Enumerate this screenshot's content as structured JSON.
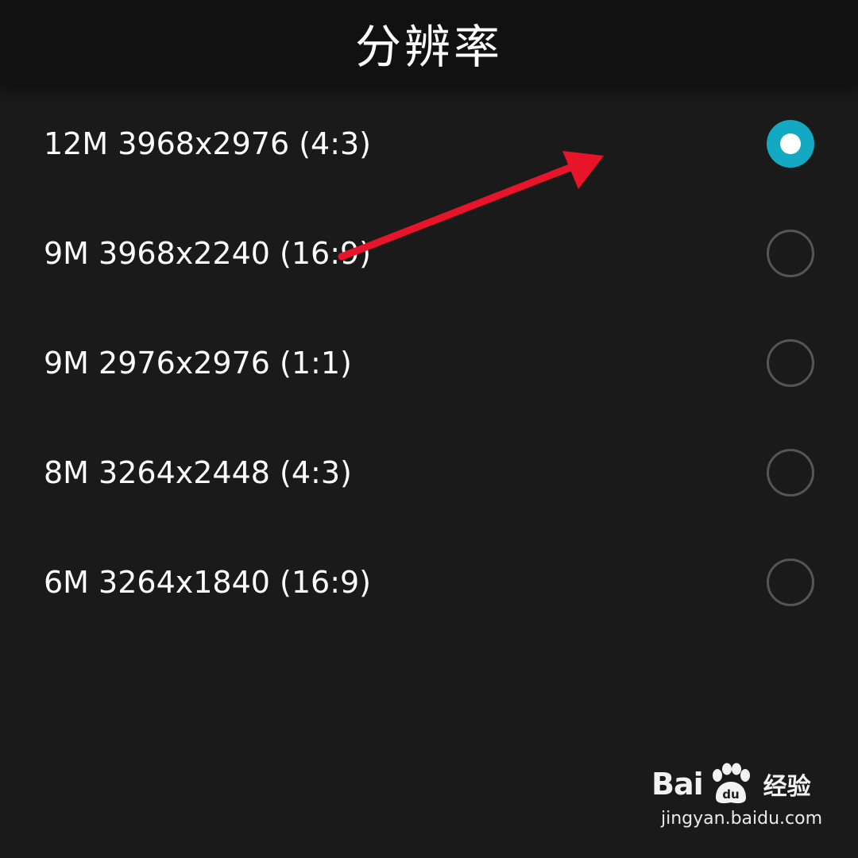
{
  "header": {
    "title": "分辨率"
  },
  "options": [
    {
      "label": "12M 3968x2976 (4:3)",
      "selected": true
    },
    {
      "label": "9M 3968x2240 (16:9)",
      "selected": false
    },
    {
      "label": "9M 2976x2976 (1:1)",
      "selected": false
    },
    {
      "label": "8M 3264x2448 (4:3)",
      "selected": false
    },
    {
      "label": "6M 3264x1840 (16:9)",
      "selected": false
    }
  ],
  "colors": {
    "background": "#1a1a1a",
    "header_background": "#111111",
    "accent": "#14a9c2",
    "annotation_arrow": "#e8142a"
  },
  "watermark": {
    "brand": "Bai",
    "brand_suffix": "du",
    "brand_cn": "经验",
    "url": "jingyan.baidu.com",
    "icon": "paw-icon"
  }
}
